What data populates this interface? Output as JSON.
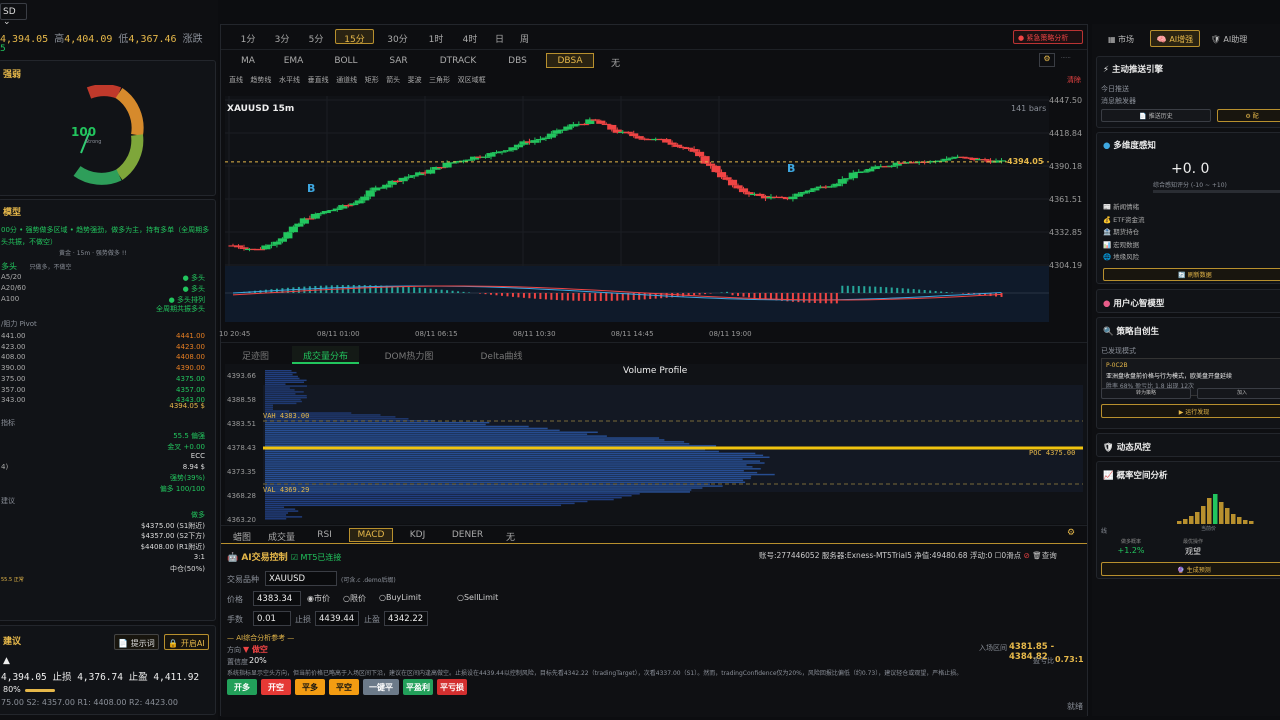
{
  "symbol_select": "SD",
  "quote": {
    "price": "4,394.05",
    "high_label": "高",
    "high": "4,404.09",
    "low_label": "低",
    "low": "4,367.46",
    "change_label": "涨跌",
    "sub": "5"
  },
  "gauge": {
    "title": "强弱",
    "value": "100",
    "sub": "Strong"
  },
  "model": {
    "title": "模型",
    "summary": "00分 • 强势做多区域 • 趋势强劲，做多为主，持有多单（全周期多头共振，不做空）",
    "sub": "黄金 · 15m · 强势做多 !!",
    "trend_label": "多头",
    "trend_note": "只做多，不做空",
    "ma": [
      {
        "k": "A5/20",
        "v": "多头"
      },
      {
        "k": "A20/60",
        "v": "多头"
      },
      {
        "k": "A100",
        "v": "多头排列"
      }
    ],
    "full": "全周期共振多头",
    "pivot_title": "/阻力 Pivot",
    "levels": [
      [
        "441.00",
        "4441.00"
      ],
      [
        "423.00",
        "4423.00"
      ],
      [
        "408.00",
        "4408.00"
      ],
      [
        "390.00",
        "4390.00"
      ],
      [
        "375.00",
        "4375.00"
      ],
      [
        "357.00",
        "4357.00"
      ],
      [
        "343.00",
        "4343.00"
      ]
    ],
    "cur": "4394.05 $",
    "ind_title": "指标",
    "inds": [
      {
        "k": "",
        "v": "55.5 偏强"
      },
      {
        "k": "",
        "v": "金叉 +0.00"
      },
      {
        "k": "",
        "v": "ECC"
      },
      {
        "k": "4)",
        "v": "8.94 $"
      },
      {
        "k": "",
        "v": "强势(39%)"
      },
      {
        "k": "",
        "v": "偏多 100/100"
      }
    ],
    "sug_title": "建议",
    "sugs": [
      {
        "k": "",
        "v": "做多"
      },
      {
        "k": "",
        "v": "$4375.00 (S1附近)"
      },
      {
        "k": "",
        "v": "$4357.00 (S2下方)"
      },
      {
        "k": "",
        "v": "$4408.00 (R1附近)"
      },
      {
        "k": "",
        "v": "3:1"
      },
      {
        "k": "",
        "v": "中仓(50%)"
      }
    ],
    "footnote": "55.5 正常"
  },
  "advice": {
    "title": "建议",
    "prompt_btn": "提示词",
    "ai_btn": "开启AI",
    "dir": "▲",
    "line": "4,394.05 止损 4,376.74 止盈 4,411.92",
    "pct": "80%",
    "levels": "75.00 S2: 4357.00 R1: 4408.00 R2: 4423.00"
  },
  "timeframes": [
    "1分",
    "3分",
    "5分",
    "15分",
    "30分",
    "1时",
    "4时",
    "日",
    "周"
  ],
  "active_tf": "15分",
  "emergency_btn": "紧急策略分析",
  "indicators": [
    "MA",
    "EMA",
    "BOLL",
    "SAR",
    "DTRACK",
    "DBS",
    "DBSA",
    "无"
  ],
  "active_ind": "DBSA",
  "draw_tools": [
    "直线",
    "趋势线",
    "水平线",
    "垂直线",
    "通道线",
    "矩形",
    "箭头",
    "斐波",
    "三角形",
    "双区域框"
  ],
  "clear": "清除",
  "chart": {
    "symbol": "XAUUSD 15m",
    "bars": "141 bars",
    "price_tag": "4394.05",
    "yticks": [
      "4447.50",
      "4418.84",
      "4390.18",
      "4361.51",
      "4332.85",
      "4304.19"
    ],
    "xticks": [
      "10 20:45",
      "08/11 01:00",
      "08/11 06:15",
      "08/11 10:30",
      "08/11 14:45",
      "08/11 19:00"
    ]
  },
  "chart_data": {
    "type": "candlestick",
    "symbol": "XAUUSD",
    "interval": "15m",
    "ylim": [
      4304.19,
      4447.5
    ],
    "last": 4394.05,
    "keypoints": [
      4322,
      4318,
      4328,
      4345,
      4352,
      4358,
      4372,
      4380,
      4385,
      4393,
      4398,
      4402,
      4410,
      4415,
      4425,
      4430,
      4420,
      4415,
      4412,
      4405,
      4388,
      4370,
      4364,
      4362,
      4370,
      4375,
      4385,
      4390,
      4395,
      4394,
      4398,
      4396,
      4394
    ]
  },
  "bottom_tabs": [
    "足迹图",
    "成交量分布",
    "DOM热力图",
    "Delta曲线"
  ],
  "active_bottom": "成交量分布",
  "vp": {
    "title": "Volume Profile",
    "vah": "VAH 4383.00",
    "poc": "POC 4375.00",
    "val": "VAL 4369.29",
    "yticks": [
      "4393.66",
      "4388.58",
      "4383.51",
      "4378.43",
      "4373.35",
      "4368.28",
      "4363.20"
    ]
  },
  "sub_ind": [
    "蜡图",
    "成交量",
    "RSI",
    "MACD",
    "KDJ",
    "DENER",
    "无"
  ],
  "active_sub": "MACD",
  "trade": {
    "title": "AI交易控制",
    "mt5": "MT5已连接",
    "account": "账号:277446052 服务器:Exness-MT5Trial5 净值:49480.68 浮动:0",
    "quick": "0滑点",
    "query": "查询",
    "sym_label": "交易品种",
    "sym": "XAUUSD",
    "sym_note": "(可含.c .demo后缀)",
    "price_label": "价格",
    "price": "4383.34",
    "types": [
      "市价",
      "限价",
      "BuyLimit",
      "SellLimit"
    ],
    "lot_label": "手数",
    "lot": "0.01",
    "sl_label": "止损",
    "sl": "4439.44",
    "tp_label": "止盈",
    "tp": "4342.22",
    "ref_title": "— AI综合分析参考 —",
    "dir_label": "方向",
    "dir": "▼ 做空",
    "conf_label": "置信度",
    "conf": "20%",
    "range_label": "入场区间",
    "range": "4381.85 - 4384.82",
    "rr_label": "盈亏比",
    "rr": "0.73:1",
    "note": "系统指标显示空头方向，但当前价格已略高于入场区间下沿，建议在区间内逢高做空。止损设在4439.44以控制风险，目标先看4342.22（tradingTarget），次看4337.00（S1）。然而，tradingConfidence仅为20%，风险回报比偏低（约0.73），建议轻仓或观望，严格止损。",
    "btns": [
      "开多",
      "开空",
      "平多",
      "平空",
      "一键平",
      "平盈利",
      "平亏损"
    ],
    "status": "就绪"
  },
  "right": {
    "tabs": [
      "市场",
      "AI增强",
      "AI助理"
    ],
    "active": "AI增强",
    "engine": "主动推送引擎",
    "today": "今日推送",
    "trigger": "消息触发器",
    "history_btn": "推送历史",
    "config_btn": "配",
    "multi": "多维度感知",
    "score": "+0. 0",
    "score_label": "综合感知评分 (-10 ~ +10)",
    "sensors": [
      "新闻情绪",
      "ETF资金流",
      "期货持仓",
      "宏观数据",
      "地缘风险"
    ],
    "refresh": "刷新数据",
    "mind": "用户心智模型",
    "strategy": "策略自创生",
    "found": "已发现模式",
    "pattern_id": "P-0C2B",
    "pattern_desc": "亚洲盘收盘前价格与行为模式，欧美盘开盘延续",
    "pattern_stats": "胜率 68% 盈亏比 1.8 出现 12次",
    "to_rule": "转为策略",
    "add": "加入",
    "run_bt": "运行发现",
    "risk": "动态风控",
    "prob": "概率空间分析",
    "calc": "当前价",
    "stats": [
      {
        "k": "做多概率",
        "v": "+1.2%"
      },
      {
        "k": "最优操作",
        "v": "观望"
      },
      {
        "k": "",
        "v": ""
      }
    ],
    "gen": "生成预测",
    "hist": [
      3,
      5,
      8,
      12,
      18,
      26,
      30,
      22,
      16,
      10,
      7,
      4,
      3
    ]
  }
}
